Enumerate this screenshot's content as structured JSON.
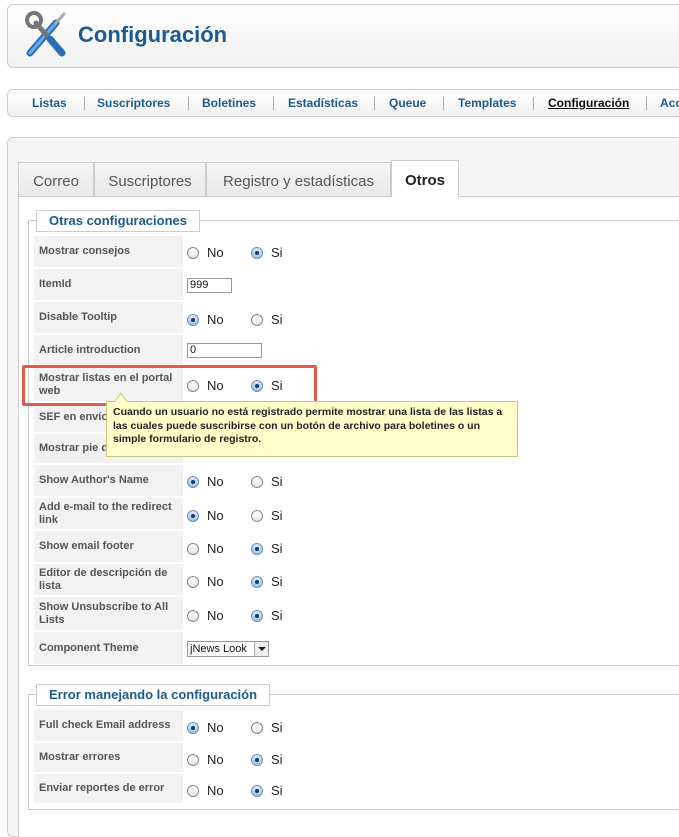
{
  "header": {
    "title": "Configuración",
    "icon": "tools-icon"
  },
  "nav": {
    "items": [
      {
        "label": "Listas"
      },
      {
        "label": "Suscriptores"
      },
      {
        "label": "Boletines"
      },
      {
        "label": "Estadísticas"
      },
      {
        "label": "Queue"
      },
      {
        "label": "Templates"
      },
      {
        "label": "Configuración",
        "active": true
      },
      {
        "label": "Acc"
      }
    ]
  },
  "tabs": [
    {
      "label": "Correo"
    },
    {
      "label": "Suscriptores"
    },
    {
      "label": "Registro y estadísticas"
    },
    {
      "label": "Otros",
      "active": true
    }
  ],
  "section1": {
    "legend": "Otras configuraciones",
    "rows": [
      {
        "label": "Mostrar consejos",
        "no": "No",
        "si": "Si",
        "value": "Si"
      },
      {
        "label": "ItemId",
        "input": "999"
      },
      {
        "label": "Disable Tooltip",
        "no": "No",
        "si": "Si",
        "value": "No"
      },
      {
        "label": "Article introduction",
        "input": "0"
      },
      {
        "label": "Mostrar listas en el portal web",
        "no": "No",
        "si": "Si",
        "value": "Si"
      },
      {
        "label": "SEF en envío"
      },
      {
        "label": "Mostrar pie de"
      },
      {
        "label": "Show Author's Name",
        "no": "No",
        "si": "Si",
        "value": "No"
      },
      {
        "label": "Add e-mail to the redirect link",
        "no": "No",
        "si": "Si",
        "value": "No"
      },
      {
        "label": "Show email footer",
        "no": "No",
        "si": "Si",
        "value": "Si"
      },
      {
        "label": "Editor de descripción de lista",
        "no": "No",
        "si": "Si",
        "value": "Si"
      },
      {
        "label": "Show Unsubscribe to All Lists",
        "no": "No",
        "si": "Si",
        "value": "Si"
      },
      {
        "label": "Component Theme",
        "select": "jNews Look"
      }
    ]
  },
  "section2": {
    "legend": "Error manejando la configuración",
    "rows": [
      {
        "label": "Full check Email address",
        "no": "No",
        "si": "Si",
        "value": "No"
      },
      {
        "label": "Mostrar errores",
        "no": "No",
        "si": "Si",
        "value": "Si"
      },
      {
        "label": "Enviar reportes de error",
        "no": "No",
        "si": "Si",
        "value": "Si"
      }
    ]
  },
  "tooltip": {
    "text": "Cuando un usuario no está registrado permite mostrar una lista de las listas a las cuales puede suscribirse con un botón de archivo para boletines o un simple formulario de registro."
  },
  "colors": {
    "accent": "#1d5b8e",
    "highlight": "#e05b4a",
    "tooltip_bg": "#ffffc9"
  }
}
